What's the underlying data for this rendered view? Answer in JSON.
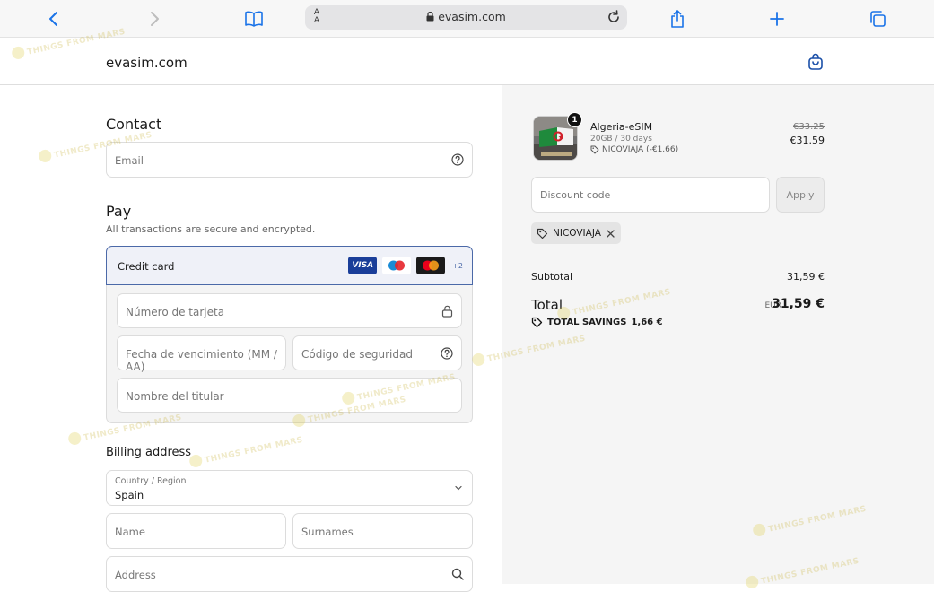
{
  "browser": {
    "reader_label": "A\nA",
    "url": "evasim.com"
  },
  "site": {
    "brand": "evasim.com"
  },
  "contact": {
    "heading": "Contact",
    "email_placeholder": "Email"
  },
  "pay": {
    "heading": "Pay",
    "subtitle": "All transactions are secure and encrypted.",
    "method_label": "Credit card",
    "card_brands": [
      "VISA",
      "maestro",
      "mastercard"
    ],
    "more_brands": "+2",
    "card_number_placeholder": "Número de tarjeta",
    "expiry_placeholder": "Fecha de vencimiento (MM / AA)",
    "cvc_placeholder": "Código de seguridad",
    "holder_placeholder": "Nombre del titular"
  },
  "billing": {
    "heading": "Billing address",
    "country_label": "Country / Region",
    "country_value": "Spain",
    "name_placeholder": "Name",
    "surnames_placeholder": "Surnames",
    "address_placeholder": "Address"
  },
  "order": {
    "product_name": "Algeria-eSIM",
    "variant": "20GB / 30 days",
    "discount_tag": "NICOVIAJA (-€1.66)",
    "quantity": "1",
    "price_original": "€33.25",
    "price_final": "€31.59",
    "discount_placeholder": "Discount code",
    "apply_label": "Apply",
    "applied_code": "NICOVIAJA",
    "subtotal_label": "Subtotal",
    "subtotal_value": "31,59 €",
    "total_label": "Total",
    "total_currency": "EUR",
    "total_value": "31,59 €",
    "savings_label": "TOTAL SAVINGS",
    "savings_value": "1,66 €"
  },
  "watermark": "THINGS FROM MARS",
  "colors": {
    "accent": "#4b69a8",
    "link_blue": "#1a73e8",
    "summary_bg": "#f5f5f5"
  }
}
